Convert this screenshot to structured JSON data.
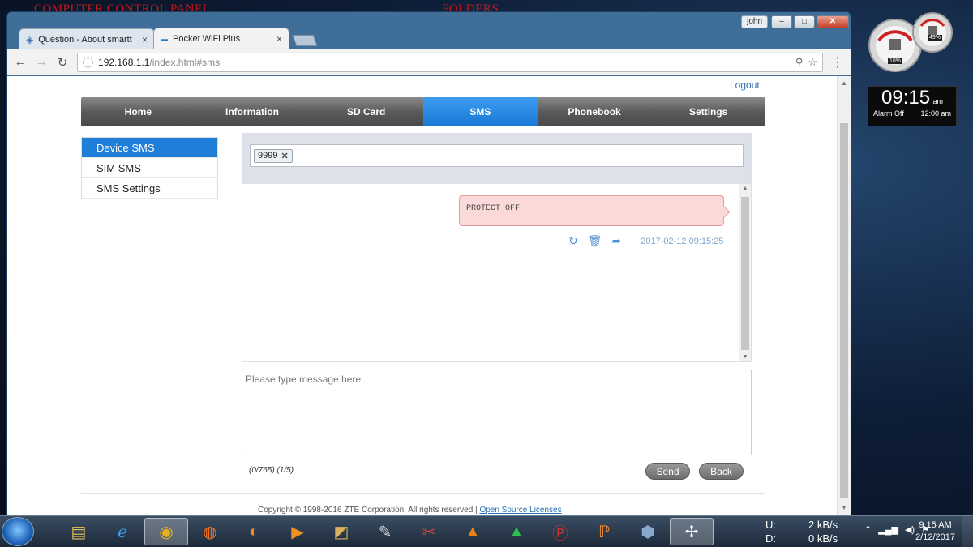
{
  "desktop": {
    "label_left": "COMPUTER CONTROL PANEL",
    "label_right": "FOLDERS"
  },
  "window": {
    "user": "john",
    "min": "–",
    "max": "□",
    "close": "✕"
  },
  "tabs": [
    {
      "title": "Question - About smartt",
      "close": "×"
    },
    {
      "title": "Pocket WiFi Plus",
      "close": "×"
    }
  ],
  "address": {
    "host": "192.168.1.1",
    "path": "/index.html#sms"
  },
  "page": {
    "logout": "Logout",
    "nav": [
      "Home",
      "Information",
      "SD Card",
      "SMS",
      "Phonebook",
      "Settings"
    ],
    "nav_active": "SMS",
    "side": [
      "Device SMS",
      "SIM SMS",
      "SMS Settings"
    ],
    "recipient": "9999",
    "message": {
      "text": "PROTECT OFF",
      "time": "2017-02-12 09:15:25"
    },
    "compose_placeholder": "Please type message here",
    "counter": "(0/765) (1/5)",
    "send": "Send",
    "back": "Back",
    "copyright": "Copyright © 1998-2016 ZTE Corporation. All rights reserved  |",
    "oss": "Open Source Licenses"
  },
  "gadgets": {
    "cpu": "10%",
    "mem": "49%",
    "time": "09:15",
    "ampm": "am",
    "alarm": "Alarm Off",
    "alarm_time": "12:00 am"
  },
  "tray": {
    "up_label": "U:",
    "up": "2 kB/s",
    "down_label": "D:",
    "down": "0 kB/s",
    "time": "9:15 AM",
    "date": "2/12/2017"
  },
  "colors": {
    "accent": "#1f7fd8",
    "bubble": "#fcd9d9",
    "navbar": "#5a5a5a"
  }
}
